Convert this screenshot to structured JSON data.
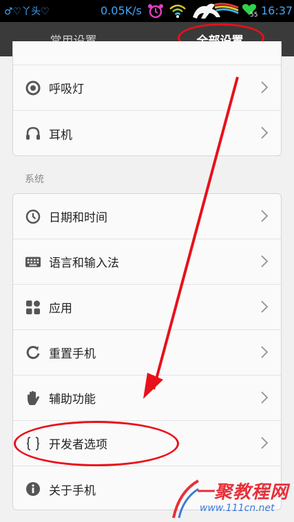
{
  "status_bar": {
    "left_text": "♂♡丫头♡",
    "speed": "0.05K/s",
    "battery_level": "55",
    "time": "16:37"
  },
  "tabs": [
    {
      "label": "常用设置",
      "active": false
    },
    {
      "label": "全部设置",
      "active": true
    }
  ],
  "top_group": {
    "items": [
      {
        "label": "呼吸灯",
        "icon": "breathing-light-icon"
      },
      {
        "label": "耳机",
        "icon": "headphones-icon"
      }
    ]
  },
  "system_section": {
    "title": "系统",
    "items": [
      {
        "label": "日期和时间",
        "icon": "clock-icon"
      },
      {
        "label": "语言和输入法",
        "icon": "keyboard-icon"
      },
      {
        "label": "应用",
        "icon": "apps-icon"
      },
      {
        "label": "重置手机",
        "icon": "reset-icon"
      },
      {
        "label": "辅助功能",
        "icon": "hand-icon"
      },
      {
        "label": "开发者选项",
        "icon": "braces-icon"
      },
      {
        "label": "关于手机",
        "icon": "info-icon"
      }
    ]
  },
  "watermark": {
    "title": "一聚教程网",
    "url": "www.111cn.net"
  },
  "colors": {
    "annotation": "#e8101a",
    "status_text": "#3fa7ff",
    "tab_bar": "#3a3a3a"
  }
}
